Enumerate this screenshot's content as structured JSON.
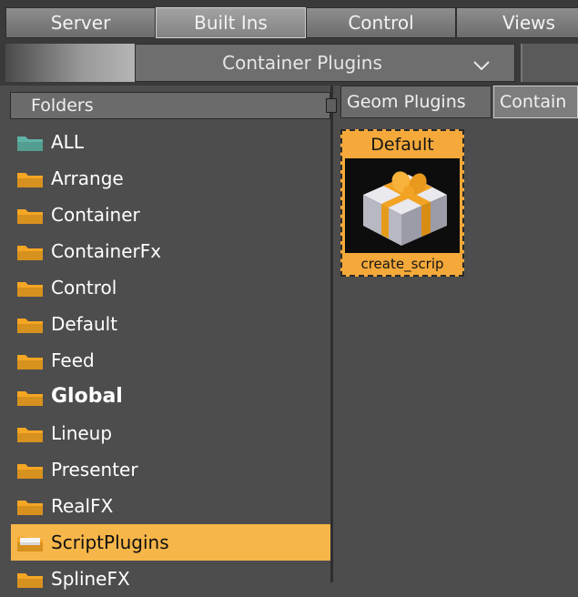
{
  "top_tabs": [
    {
      "label": "Server",
      "active": false
    },
    {
      "label": "Built Ins",
      "active": true
    },
    {
      "label": "Control",
      "active": false
    },
    {
      "label": "Views",
      "active": false
    }
  ],
  "plugin_category": {
    "selected": "Container Plugins",
    "arrow_icon": "chevron-down-icon"
  },
  "folders": {
    "header": "Folders",
    "items": [
      {
        "label": "ALL",
        "icon": "folder-all-icon",
        "color": "#5fb3a6",
        "bold": false,
        "selected": false
      },
      {
        "label": "Arrange",
        "icon": "folder-icon",
        "color": "#f5a623",
        "bold": false,
        "selected": false
      },
      {
        "label": "Container",
        "icon": "folder-icon",
        "color": "#f5a623",
        "bold": false,
        "selected": false
      },
      {
        "label": "ContainerFx",
        "icon": "folder-icon",
        "color": "#f5a623",
        "bold": false,
        "selected": false
      },
      {
        "label": "Control",
        "icon": "folder-icon",
        "color": "#f5a623",
        "bold": false,
        "selected": false
      },
      {
        "label": "Default",
        "icon": "folder-icon",
        "color": "#f5a623",
        "bold": false,
        "selected": false
      },
      {
        "label": "Feed",
        "icon": "folder-icon",
        "color": "#f5a623",
        "bold": false,
        "selected": false
      },
      {
        "label": "Global",
        "icon": "folder-icon",
        "color": "#f5a623",
        "bold": true,
        "selected": false
      },
      {
        "label": "Lineup",
        "icon": "folder-icon",
        "color": "#f5a623",
        "bold": false,
        "selected": false
      },
      {
        "label": "Presenter",
        "icon": "folder-icon",
        "color": "#f5a623",
        "bold": false,
        "selected": false
      },
      {
        "label": "RealFX",
        "icon": "folder-icon",
        "color": "#f5a623",
        "bold": false,
        "selected": false
      },
      {
        "label": "ScriptPlugins",
        "icon": "folder-open-icon",
        "color": "#f5a623",
        "bold": false,
        "selected": true
      },
      {
        "label": "SplineFX",
        "icon": "folder-icon",
        "color": "#f5a623",
        "bold": false,
        "selected": false
      }
    ]
  },
  "right_tabs": [
    {
      "label": "Geom Plugins",
      "active": false
    },
    {
      "label": "Contain",
      "active": true
    }
  ],
  "plugin_tile": {
    "title": "Default",
    "caption": "create_scrip",
    "icon": "gift-box-icon",
    "highlight_color": "#f4a93a"
  },
  "colors": {
    "background": "#4d4d4d",
    "selection": "#f7b64a",
    "folder": "#f5a623"
  }
}
